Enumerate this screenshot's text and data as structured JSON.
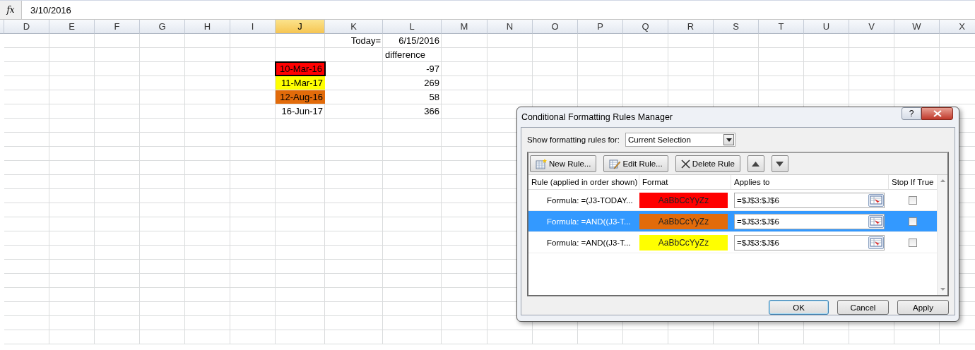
{
  "formula_bar": {
    "function_label": "fx",
    "value": "3/10/2016"
  },
  "columns": [
    {
      "label": "D",
      "selected": false
    },
    {
      "label": "E",
      "selected": false
    },
    {
      "label": "F",
      "selected": false
    },
    {
      "label": "G",
      "selected": false
    },
    {
      "label": "H",
      "selected": false
    },
    {
      "label": "I",
      "selected": false
    },
    {
      "label": "J",
      "selected": true
    },
    {
      "label": "K",
      "selected": false
    },
    {
      "label": "L",
      "selected": false
    },
    {
      "label": "M",
      "selected": false
    },
    {
      "label": "N",
      "selected": false
    },
    {
      "label": "O",
      "selected": false
    },
    {
      "label": "P",
      "selected": false
    },
    {
      "label": "Q",
      "selected": false
    },
    {
      "label": "R",
      "selected": false
    },
    {
      "label": "S",
      "selected": false
    },
    {
      "label": "T",
      "selected": false
    },
    {
      "label": "U",
      "selected": false
    },
    {
      "label": "V",
      "selected": false
    },
    {
      "label": "W",
      "selected": false
    },
    {
      "label": "X",
      "selected": false
    }
  ],
  "sheet": {
    "today_label": "Today=",
    "today": "6/15/2016",
    "difference_header": "difference",
    "entries": [
      {
        "date": "10-Mar-16",
        "color": "#ff0000",
        "selected": true,
        "difference": "-97"
      },
      {
        "date": "11-Mar-17",
        "color": "#ffff00",
        "selected": false,
        "difference": "269"
      },
      {
        "date": "12-Aug-16",
        "color": "#e26b0a",
        "selected": false,
        "difference": "58"
      },
      {
        "date": "16-Jun-17",
        "selected": false,
        "difference": "366"
      }
    ]
  },
  "dialog": {
    "title": "Conditional Formatting Rules Manager",
    "help": "?",
    "show_label": "Show formatting rules for:",
    "scope": "Current Selection",
    "toolbar": [
      {
        "kind": "new",
        "label": "New Rule..."
      },
      {
        "kind": "edit",
        "label": "Edit Rule..."
      },
      {
        "kind": "delete",
        "label": "Delete Rule"
      },
      {
        "kind": "up"
      },
      {
        "kind": "down"
      }
    ],
    "headers": [
      "Rule (applied in order shown)",
      "Format",
      "Applies to",
      "Stop If True"
    ],
    "rules": [
      {
        "rule": "Formula: =(J3-TODAY...",
        "preview": "AaBbCcYyZz",
        "color": "#ff0000",
        "applies_to": "=$J$3:$J$6",
        "stop_if_true": false,
        "selected": false
      },
      {
        "rule": "Formula: =AND((J3-T...",
        "preview": "AaBbCcYyZz",
        "color": "#e26b0a",
        "applies_to": "=$J$3:$J$6",
        "stop_if_true": false,
        "selected": true
      },
      {
        "rule": "Formula: =AND((J3-T...",
        "preview": "AaBbCcYyZz",
        "color": "#ffff00",
        "applies_to": "=$J$3:$J$6",
        "stop_if_true": false,
        "selected": false
      }
    ],
    "buttons": [
      {
        "label": "OK",
        "default": true
      },
      {
        "label": "Cancel",
        "default": false
      },
      {
        "label": "Apply",
        "default": false
      }
    ]
  }
}
